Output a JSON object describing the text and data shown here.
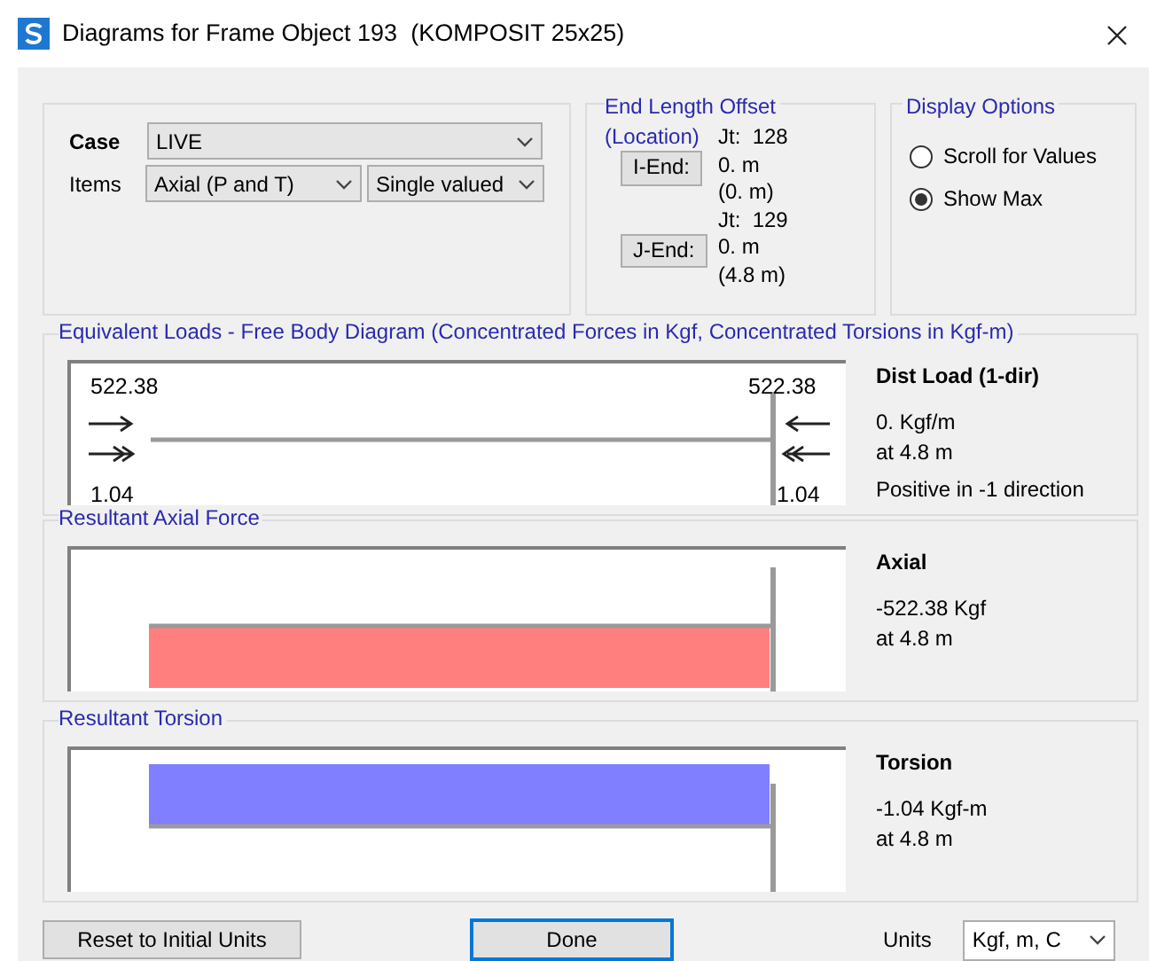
{
  "window": {
    "title": "Diagrams for Frame Object 193  (KOMPOSIT 25x25)"
  },
  "case": {
    "label": "Case",
    "value": "LIVE"
  },
  "items": {
    "label": "Items",
    "value": "Axial (P and T)",
    "mode": "Single valued"
  },
  "end_length_offset": {
    "title": "End Length Offset",
    "subtitle": "(Location)",
    "ends": [
      {
        "button": "I-End:",
        "joint": "Jt:  128",
        "offset": "0. m",
        "location": "(0. m)"
      },
      {
        "button": "J-End:",
        "joint": "Jt:  129",
        "offset": "0. m",
        "location": "(4.8 m)"
      }
    ]
  },
  "display_options": {
    "title": "Display Options",
    "options": [
      {
        "label": "Scroll for Values",
        "selected": false
      },
      {
        "label": "Show Max",
        "selected": true
      }
    ]
  },
  "panels": [
    {
      "kind": "free_body",
      "title": "Equivalent Loads - Free Body Diagram  (Concentrated Forces in Kgf, Concentrated Torsions in Kgf-m)",
      "left_force": "522.38",
      "right_force": "522.38",
      "left_torsion": "1.04",
      "right_torsion": "1.04",
      "info_title": "Dist Load (1-dir)",
      "info_lines": [
        "0. Kgf/m",
        "at 4.8 m",
        "Positive in -1 direction"
      ]
    },
    {
      "kind": "axial",
      "title": "Resultant Axial Force",
      "info_title": "Axial",
      "info_lines": [
        "-522.38 Kgf",
        "at 4.8 m"
      ]
    },
    {
      "kind": "torsion",
      "title": "Resultant Torsion",
      "info_title": "Torsion",
      "info_lines": [
        "-1.04 Kgf-m",
        "at 4.8 m"
      ]
    }
  ],
  "footer": {
    "reset": "Reset to Initial Units",
    "done": "Done",
    "units_label": "Units",
    "units": "Kgf, m, C"
  }
}
